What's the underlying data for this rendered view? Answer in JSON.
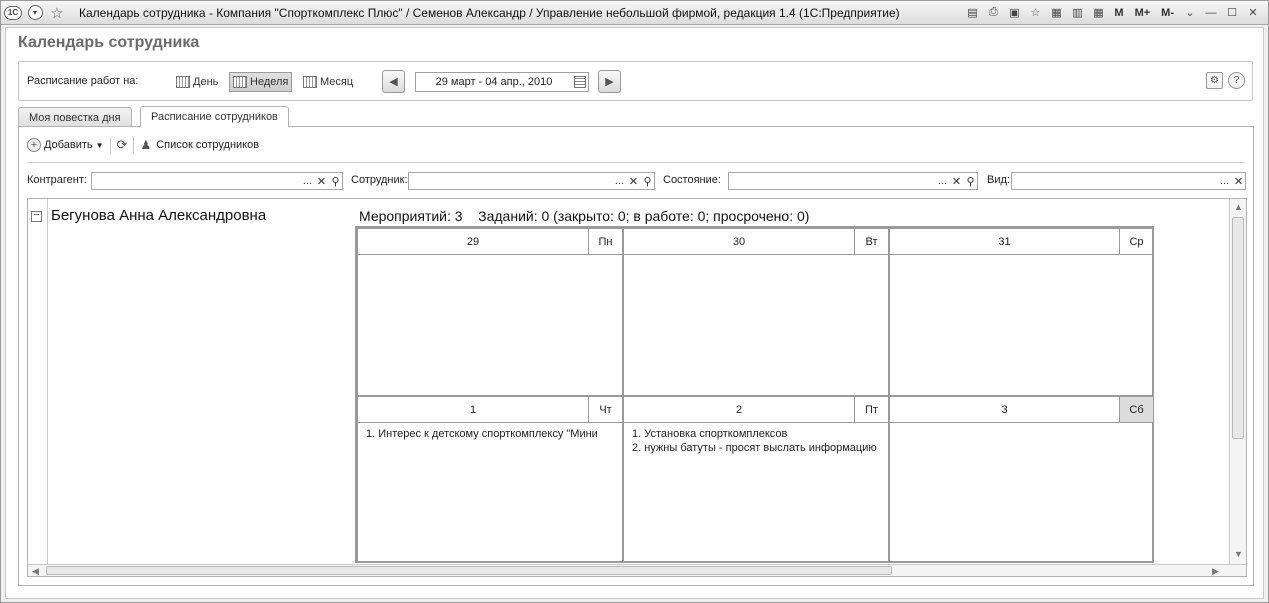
{
  "window": {
    "title": "Календарь сотрудника - Компания \"Спорткомплекс Плюс\" / Семенов Александр / Управление небольшой фирмой, редакция 1.4  (1С:Предприятие)",
    "logo_text": "1C",
    "mem_labels": [
      "M",
      "M+",
      "M-"
    ]
  },
  "page": {
    "title": "Календарь сотрудника"
  },
  "schedule": {
    "label": "Расписание работ на:",
    "views": [
      {
        "label": "День",
        "selected": false
      },
      {
        "label": "Неделя",
        "selected": true
      },
      {
        "label": "Месяц",
        "selected": false
      }
    ],
    "period": "29 март - 04 апр., 2010",
    "help_label": "?"
  },
  "tabs": [
    {
      "label": "Моя повестка дня",
      "active": false
    },
    {
      "label": "Расписание сотрудников",
      "active": true
    }
  ],
  "toolbar": {
    "add_label": "Добавить",
    "staff_list_label": "Список сотрудников"
  },
  "filters": {
    "counterparty_label": "Контрагент:",
    "employee_label": "Сотрудник:",
    "state_label": "Состояние:",
    "kind_label": "Вид:"
  },
  "employee": {
    "name": "Бегунова Анна Александровна",
    "events_summary": "Мероприятий: 3",
    "tasks_summary": "Заданий: 0 (закрыто: 0; в работе: 0; просрочено: 0)"
  },
  "days": [
    {
      "num": "29",
      "dow": "Пн",
      "events": []
    },
    {
      "num": "30",
      "dow": "Вт",
      "events": []
    },
    {
      "num": "31",
      "dow": "Ср",
      "events": []
    },
    {
      "num": "1",
      "dow": "Чт",
      "events": [
        "1. Интерес к детскому спорткомплексу \"Мини"
      ]
    },
    {
      "num": "2",
      "dow": "Пт",
      "events": [
        "1. Установка спорткомплексов",
        "2. нужны батуты - просят выслать информацию"
      ]
    },
    {
      "num": "3",
      "dow": "Сб",
      "events": []
    }
  ],
  "colors": {
    "title_gray": "#6b6b6b",
    "weekend_header": "#dcdcdc"
  }
}
